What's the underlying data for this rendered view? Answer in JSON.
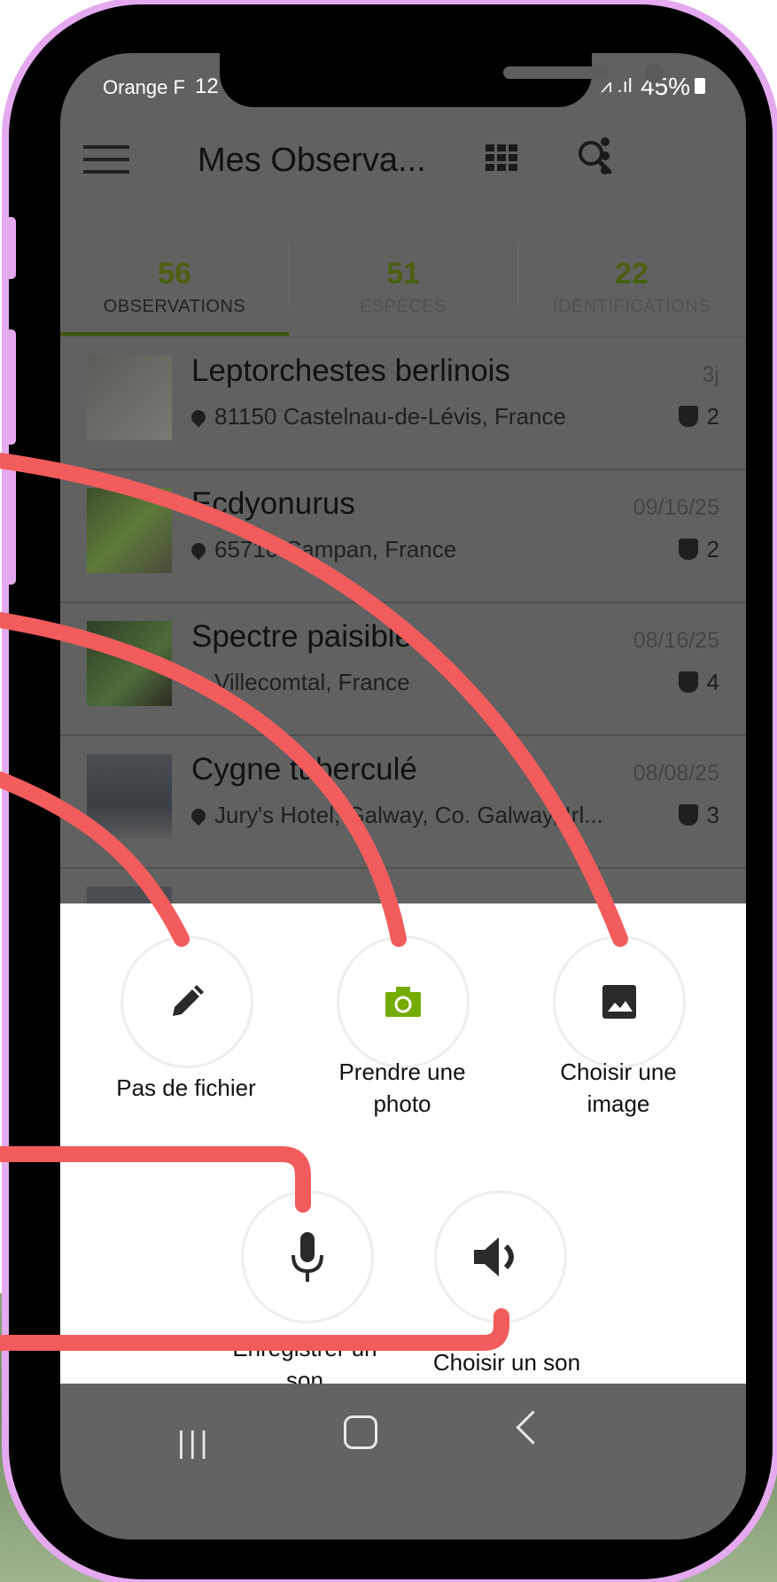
{
  "status_bar": {
    "carrier": "Orange F",
    "time": "12",
    "battery": "45%"
  },
  "app_bar": {
    "title": "Mes Observa..."
  },
  "tabs": [
    {
      "count": "56",
      "label": "OBSERVATIONS",
      "active": true
    },
    {
      "count": "51",
      "label": "ESPÈCES",
      "active": false
    },
    {
      "count": "22",
      "label": "IDENTIFICATIONS",
      "active": false
    }
  ],
  "observations": [
    {
      "title": "Leptorchestes berlinois",
      "date": "3j",
      "location": "81150 Castelnau-de-Lévis, France",
      "ids": "2"
    },
    {
      "title": "Ecdyonurus",
      "date": "09/16/25",
      "location": "65710 Campan, France",
      "ids": "2"
    },
    {
      "title": "Spectre paisible",
      "date": "08/16/25",
      "location": "Villecomtal, France",
      "ids": "4"
    },
    {
      "title": "Cygne tuberculé",
      "date": "08/08/25",
      "location": "Jury's Hotel, Galway, Co. Galway, Irl...",
      "ids": "3"
    }
  ],
  "sheet_options": {
    "no_file": "Pas de fichier",
    "take_photo": "Prendre une photo",
    "choose_image": "Choisir une image",
    "record_sound": "Enregistrer un son",
    "choose_sound": "Choisir un son"
  },
  "colors": {
    "accent": "#74ac00",
    "annotation": "#f25c5c",
    "frame": "#e5a9ef"
  }
}
